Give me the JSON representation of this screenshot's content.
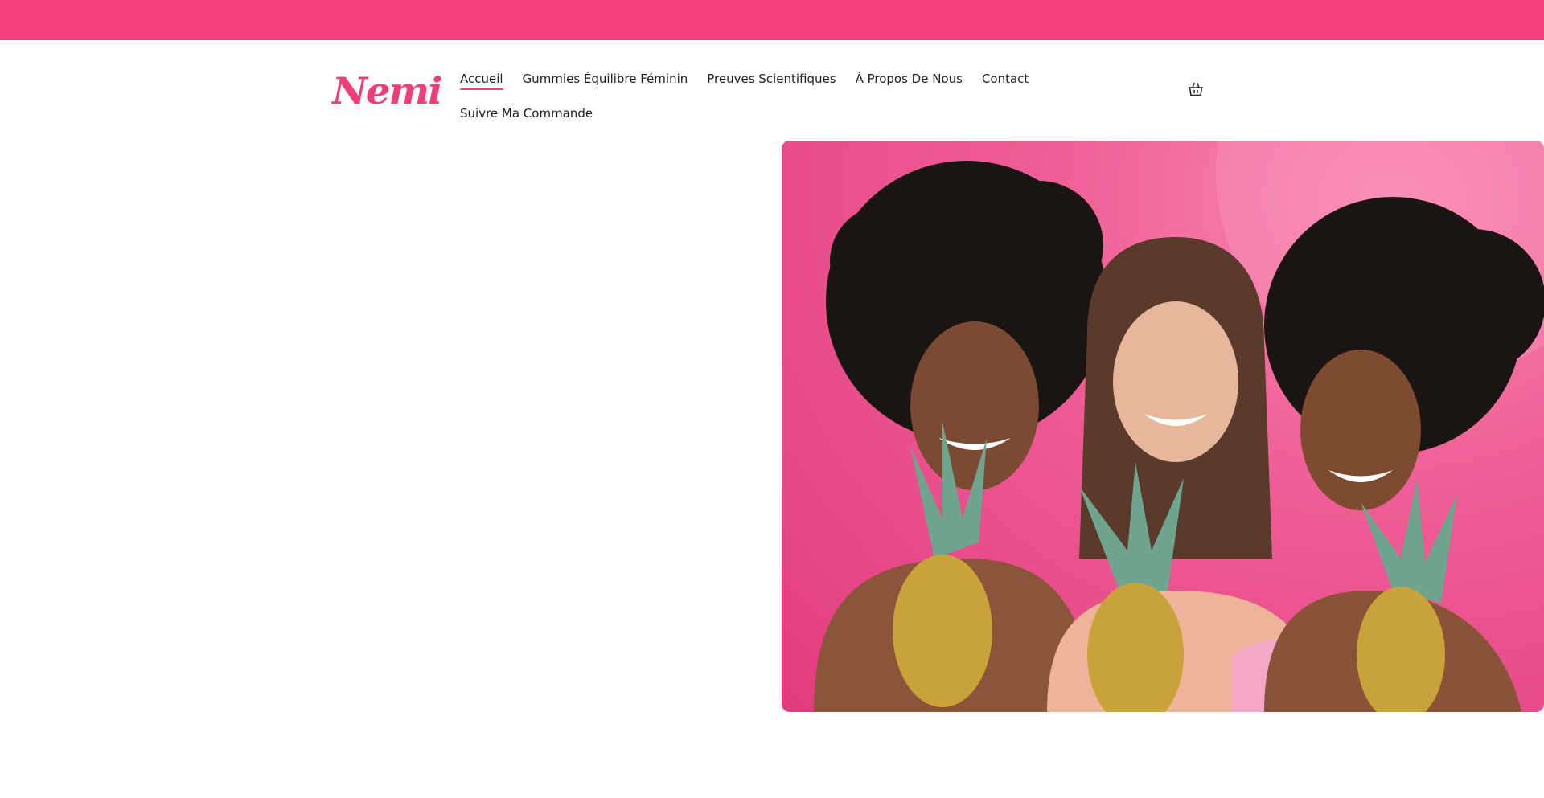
{
  "brand": {
    "logo_text": "Nemi",
    "accent_color": "#f43f7a"
  },
  "nav": {
    "items": [
      {
        "label": "Accueil",
        "active": true
      },
      {
        "label": "Gummies Équilibre Féminin",
        "active": false
      },
      {
        "label": "Preuves Scientifiques",
        "active": false
      },
      {
        "label": "À Propos De Nous",
        "active": false
      },
      {
        "label": "Contact",
        "active": false
      },
      {
        "label": "Suivre Ma Commande",
        "active": false
      }
    ]
  },
  "header": {
    "cart_icon": "shopping-basket-icon"
  },
  "hero": {
    "image_icon": "hero-photo"
  }
}
